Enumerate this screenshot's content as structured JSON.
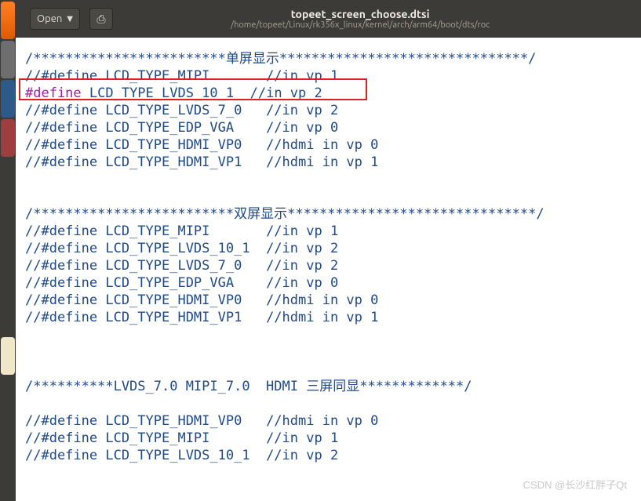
{
  "toolbar": {
    "open_label": "Open",
    "new_tab_icon": "⎙"
  },
  "title": {
    "filename": "topeet_screen_choose.dtsi",
    "path": "/home/topeet/Linux/rk356x_linux/kernel/arch/arm64/boot/dts/roc"
  },
  "code": {
    "l1": "/************************单屏显示*******************************/",
    "l2a": "//#define LCD_TYPE_MIPI",
    "l2b": "//in vp 1",
    "l3a": "#define",
    "l3b": " LCD_TYPE_LVDS_10_1",
    "l3c": "//in vp 2",
    "l4a": "//#define LCD_TYPE_LVDS_7_0",
    "l4b": "//in vp 2",
    "l5a": "//#define LCD_TYPE_EDP_VGA",
    "l5b": "//in vp 0",
    "l6a": "//#define LCD_TYPE_HDMI_VP0",
    "l6b": "//hdmi in vp 0",
    "l7a": "//#define LCD_TYPE_HDMI_VP1",
    "l7b": "//hdmi in vp 1",
    "l8": "/*************************双屏显示*******************************/",
    "l9a": "//#define LCD_TYPE_MIPI",
    "l9b": "//in vp 1",
    "l10a": "//#define LCD_TYPE_LVDS_10_1",
    "l10b": "//in vp 2",
    "l11a": "//#define LCD_TYPE_LVDS_7_0",
    "l11b": "//in vp 2",
    "l12a": "//#define LCD_TYPE_EDP_VGA",
    "l12b": "//in vp 0",
    "l13a": "//#define LCD_TYPE_HDMI_VP0",
    "l13b": "//hdmi in vp 0",
    "l14a": "//#define LCD_TYPE_HDMI_VP1",
    "l14b": "//hdmi in vp 1",
    "l15": "/**********LVDS_7.0 MIPI_7.0  HDMI 三屏同显*************/",
    "l16a": "//#define LCD_TYPE_HDMI_VP0",
    "l16b": "//hdmi in vp 0",
    "l17a": "//#define LCD_TYPE_MIPI",
    "l17b": "//in vp 1",
    "l18a": "//#define LCD_TYPE_LVDS_10_1",
    "l18b": "//in vp 2"
  },
  "watermark": "CSDN @长沙红胖子Qt"
}
